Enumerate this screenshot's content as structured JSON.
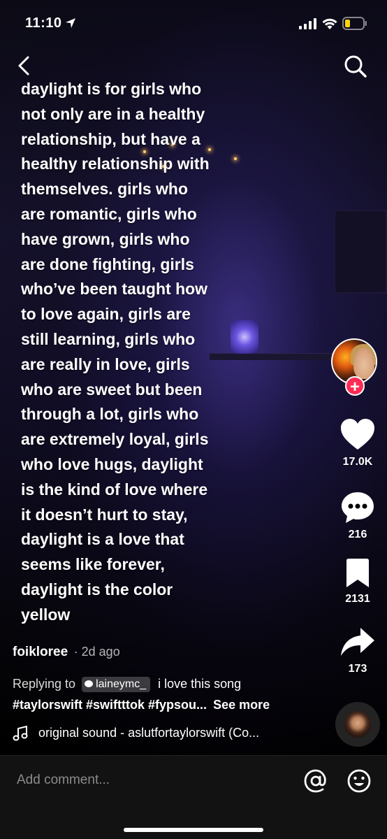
{
  "status_bar": {
    "time": "11:10",
    "battery_color": "#ffd60a"
  },
  "caption": {
    "lines": [
      "daylight is for girls who",
      "not only are in a healthy",
      "relationship, but have a",
      "healthy relationship with",
      "themselves. girls who",
      "are romantic, girls who",
      "have grown, girls who",
      "are done fighting, girls",
      "who’ve been taught how",
      "to love again, girls are",
      "still learning, girls who",
      "are really in love, girls",
      "who are sweet but been",
      "through a lot, girls who",
      "are extremely loyal, girls",
      "who love hugs, daylight",
      "is the kind of love where",
      "it doesn’t hurt to stay,",
      "daylight is a love that",
      "seems like forever,",
      "daylight is the color",
      "yellow"
    ]
  },
  "right_rail": {
    "follow_glyph": "+",
    "likes": "17.0K",
    "comments": "216",
    "saves": "2131",
    "shares": "173"
  },
  "post": {
    "username": "foikloree",
    "date": "· 2d ago",
    "reply_prefix": "Replying to",
    "reply_user": "laineymc_",
    "reply_text": "i love this song",
    "hashtags": "#taylorswift #swiftttok #fypsou...",
    "see_more": "See more",
    "sound": "original sound - aslutfortaylorswift (Co..."
  },
  "comment_bar": {
    "placeholder": "Add comment..."
  },
  "colors": {
    "accent": "#fe2c55",
    "bar_bg": "#121212"
  }
}
